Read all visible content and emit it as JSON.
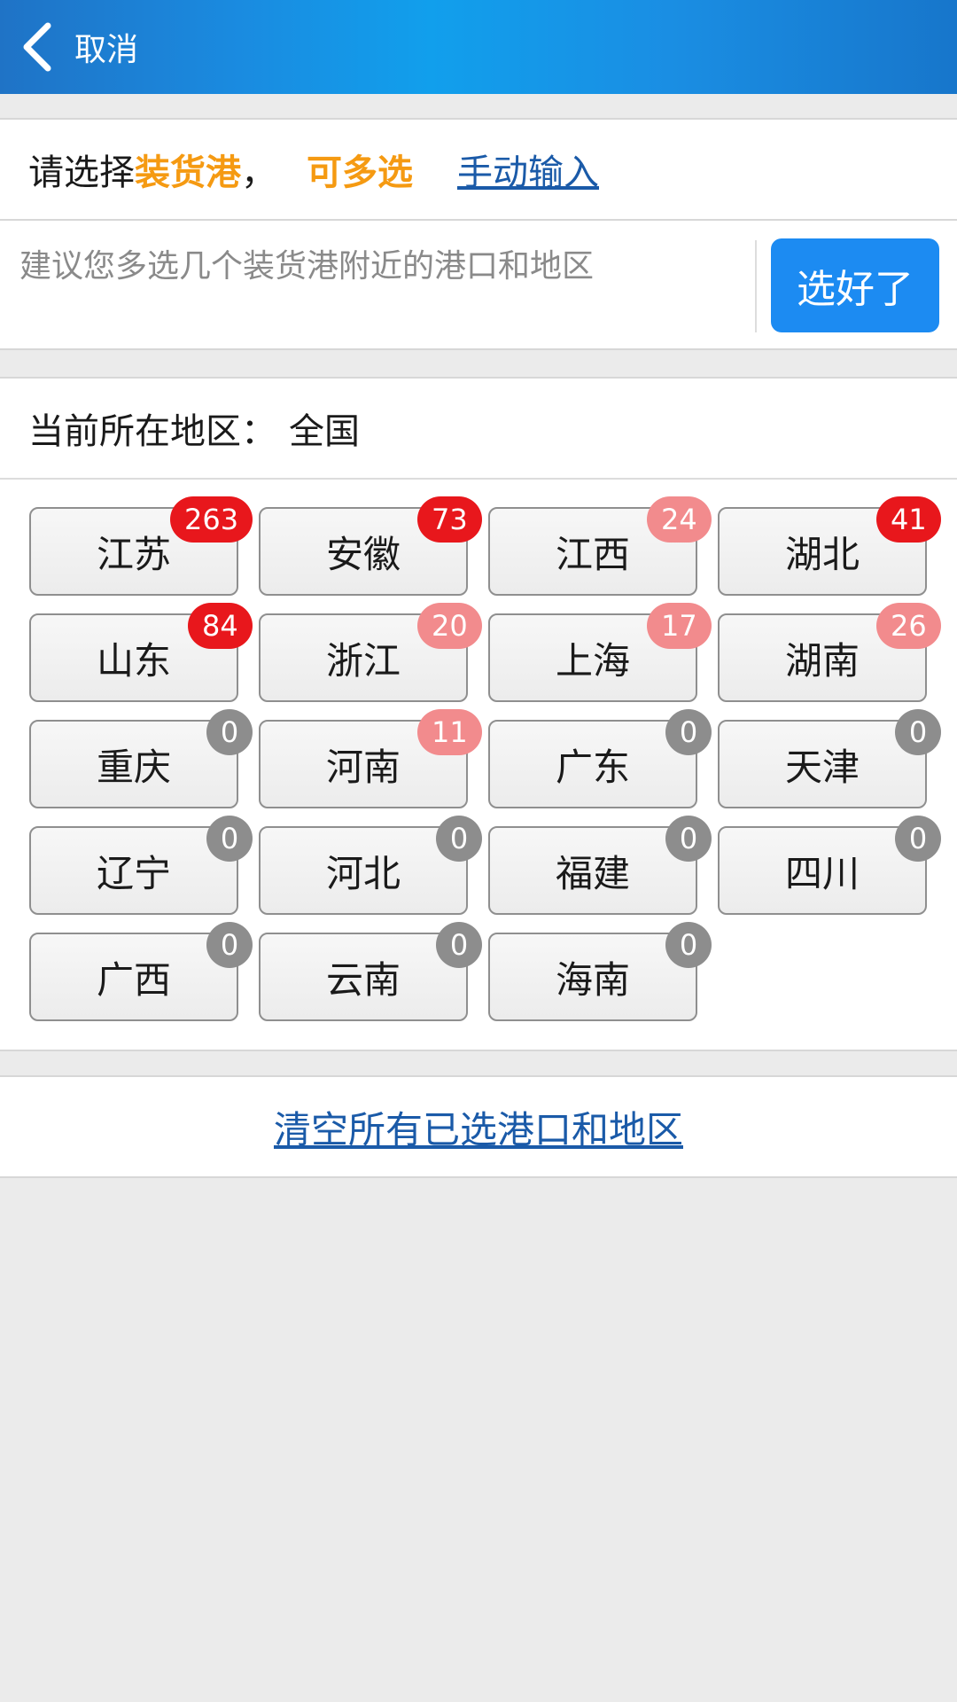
{
  "header": {
    "back_label": "取消"
  },
  "prompt": {
    "prefix": "请选择",
    "highlight": "装货港",
    "comma": "，",
    "multi": "可多选",
    "manual_link": "手动输入"
  },
  "hint": {
    "text": "建议您多选几个装货港附近的港口和地区",
    "done_button": "选好了"
  },
  "region": {
    "label": "当前所在地区：",
    "value": "全国"
  },
  "provinces": [
    {
      "name": "江苏",
      "count": "263",
      "badge": "red"
    },
    {
      "name": "安徽",
      "count": "73",
      "badge": "red"
    },
    {
      "name": "江西",
      "count": "24",
      "badge": "pink"
    },
    {
      "name": "湖北",
      "count": "41",
      "badge": "red"
    },
    {
      "name": "山东",
      "count": "84",
      "badge": "red"
    },
    {
      "name": "浙江",
      "count": "20",
      "badge": "pink"
    },
    {
      "name": "上海",
      "count": "17",
      "badge": "pink"
    },
    {
      "name": "湖南",
      "count": "26",
      "badge": "pink"
    },
    {
      "name": "重庆",
      "count": "0",
      "badge": "gray"
    },
    {
      "name": "河南",
      "count": "11",
      "badge": "pink"
    },
    {
      "name": "广东",
      "count": "0",
      "badge": "gray"
    },
    {
      "name": "天津",
      "count": "0",
      "badge": "gray"
    },
    {
      "name": "辽宁",
      "count": "0",
      "badge": "gray"
    },
    {
      "name": "河北",
      "count": "0",
      "badge": "gray"
    },
    {
      "name": "福建",
      "count": "0",
      "badge": "gray"
    },
    {
      "name": "四川",
      "count": "0",
      "badge": "gray"
    },
    {
      "name": "广西",
      "count": "0",
      "badge": "gray"
    },
    {
      "name": "云南",
      "count": "0",
      "badge": "gray"
    },
    {
      "name": "海南",
      "count": "0",
      "badge": "gray"
    }
  ],
  "clear_link": "清空所有已选港口和地区",
  "colors": {
    "header": "#1a8be0",
    "accent": "#f59a12",
    "link": "#1a5aa8",
    "badge_red": "#e8171c",
    "badge_pink": "#f28b8d",
    "badge_gray": "#8d8d8d",
    "done_button": "#1c8bf2"
  }
}
